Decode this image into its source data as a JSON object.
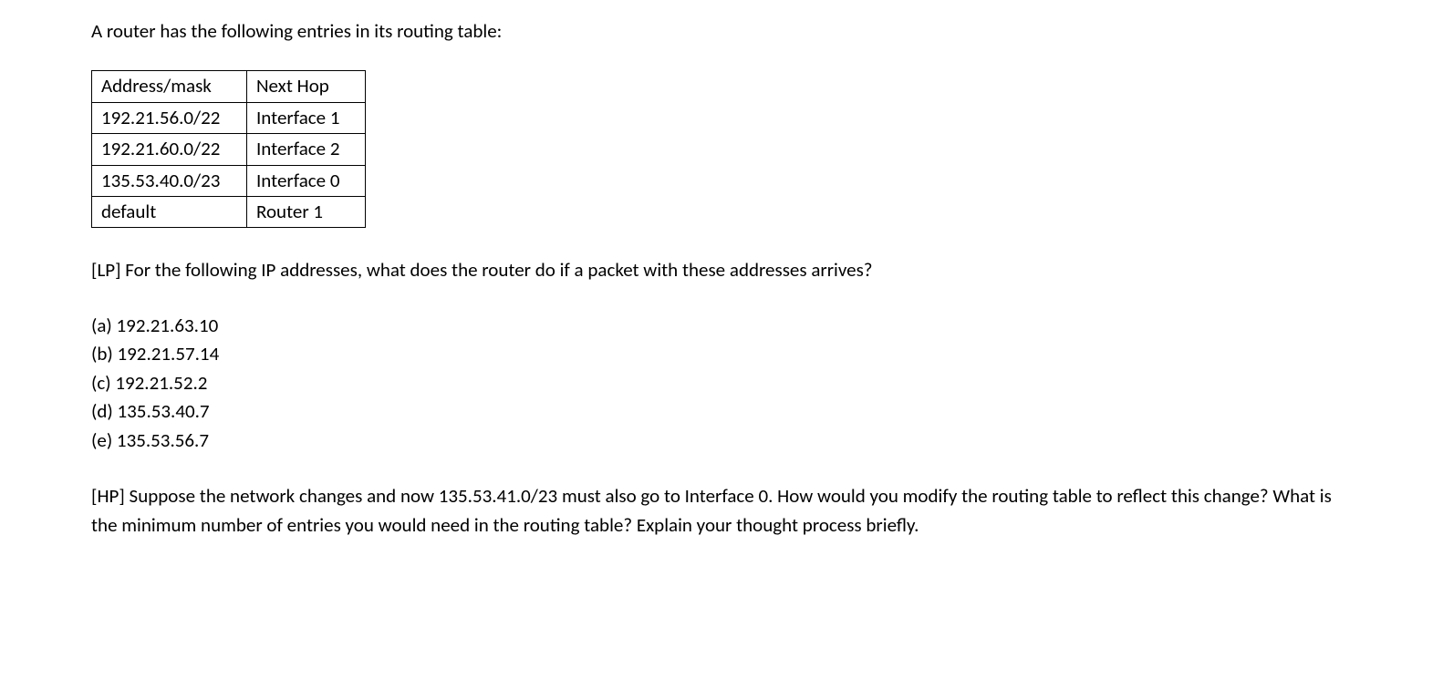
{
  "intro": "A router has the following entries in its routing table:",
  "table": {
    "headers": [
      "Address/mask",
      "Next Hop"
    ],
    "rows": [
      [
        "192.21.56.0/22",
        "Interface 1"
      ],
      [
        "192.21.60.0/22",
        "Interface 2"
      ],
      [
        "135.53.40.0/23",
        "Interface 0"
      ],
      [
        "default",
        "Router 1"
      ]
    ]
  },
  "lp_question": "[LP] For the following IP addresses, what does the router do if a packet with these addresses arrives?",
  "options": [
    "(a) 192.21.63.10",
    "(b) 192.21.57.14",
    "(c) 192.21.52.2",
    "(d) 135.53.40.7",
    "(e) 135.53.56.7"
  ],
  "hp_question": "[HP] Suppose the network changes and now 135.53.41.0/23 must also go to Interface 0. How would you modify the routing table to reflect this change? What is the minimum number of entries you would need in the routing table? Explain your thought process briefly."
}
